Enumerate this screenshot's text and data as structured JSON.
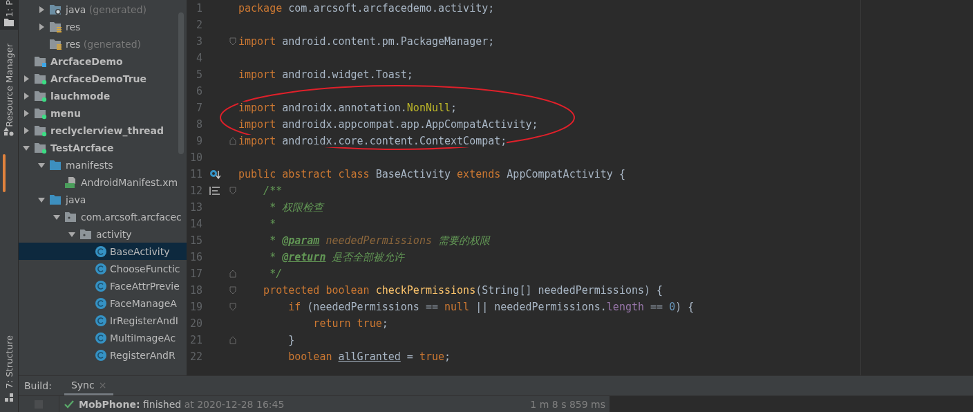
{
  "tool_strip": {
    "top_tab": "1: P",
    "middle_tab": "Resource Manager",
    "bottom_tab": "7: Structure"
  },
  "project_tree": {
    "scrolled_children": [
      {
        "label": "java",
        "suffix": "(generated)",
        "kind": "folder-generated",
        "expanded": false
      },
      {
        "label": "res",
        "kind": "folder-resources",
        "expanded": false
      },
      {
        "label": "res",
        "suffix": "(generated)",
        "kind": "folder-resources"
      }
    ],
    "items": [
      {
        "label": "ArcfaceDemo",
        "kind": "module-blue",
        "bold": true
      },
      {
        "label": "ArcfaceDemoTrue",
        "kind": "module-android",
        "bold": true,
        "expanded": false
      },
      {
        "label": "lauchmode",
        "kind": "module-android",
        "bold": true,
        "expanded": false
      },
      {
        "label": "menu",
        "kind": "module-android",
        "bold": true,
        "expanded": false
      },
      {
        "label": "reclyclerview_thread",
        "kind": "module-android",
        "bold": true,
        "expanded": false
      },
      {
        "label": "TestArcface",
        "kind": "module-android",
        "bold": true,
        "expanded": true,
        "children": [
          {
            "label": "manifests",
            "kind": "folder-blue",
            "expanded": true,
            "children": [
              {
                "label": "AndroidManifest.xm",
                "kind": "manifest"
              }
            ]
          },
          {
            "label": "java",
            "kind": "folder-blue",
            "expanded": true,
            "children": [
              {
                "label": "com.arcsoft.arcfacec",
                "kind": "package",
                "expanded": true,
                "children": [
                  {
                    "label": "activity",
                    "kind": "package",
                    "expanded": true,
                    "children": [
                      {
                        "label": "BaseActivity",
                        "kind": "class",
                        "selected": true
                      },
                      {
                        "label": "ChooseFunctic",
                        "kind": "class",
                        "selected": false
                      },
                      {
                        "label": "FaceAttrPrevie",
                        "kind": "class",
                        "selected": false
                      },
                      {
                        "label": "FaceManageA",
                        "kind": "class",
                        "selected": false
                      },
                      {
                        "label": "IrRegisterAndI",
                        "kind": "class",
                        "selected": false
                      },
                      {
                        "label": "MultiImageAc",
                        "kind": "class",
                        "selected": false
                      },
                      {
                        "label": "RegisterAndR",
                        "kind": "class",
                        "selected": false
                      }
                    ]
                  }
                ]
              }
            ]
          }
        ]
      }
    ]
  },
  "editor": {
    "lines": [
      {
        "number": "1",
        "tokens": [
          {
            "text": "package",
            "kind": "keyword"
          },
          {
            "text": " com.arcsoft.arcfacedemo.activity;",
            "kind": "plain"
          }
        ]
      },
      {
        "number": "2"
      },
      {
        "number": "3",
        "kind": "fold-open",
        "tokens": [
          {
            "text": "import",
            "kind": "keyword"
          },
          {
            "text": " android.content.pm.PackageManager;",
            "kind": "plain"
          }
        ]
      },
      {
        "number": "4"
      },
      {
        "number": "5",
        "tokens": [
          {
            "text": "import",
            "kind": "keyword"
          },
          {
            "text": " android.widget.Toast;",
            "kind": "plain"
          }
        ]
      },
      {
        "number": "6"
      },
      {
        "number": "7",
        "tokens": [
          {
            "text": "import",
            "kind": "keyword"
          },
          {
            "text": " androidx.annotation.",
            "kind": "plain"
          },
          {
            "text": "NonNull",
            "kind": "annotation"
          },
          {
            "text": ";",
            "kind": "plain"
          }
        ]
      },
      {
        "number": "8",
        "tokens": [
          {
            "text": "import",
            "kind": "keyword"
          },
          {
            "text": " androidx.appcompat.app.AppCompatActivity;",
            "kind": "plain"
          }
        ]
      },
      {
        "number": "9",
        "kind": "fold-close",
        "tokens": [
          {
            "text": "import",
            "kind": "keyword"
          },
          {
            "text": " androidx.core.content.ContextCompat;",
            "kind": "plain"
          }
        ]
      },
      {
        "number": "10"
      },
      {
        "number": "11",
        "kind": "override",
        "tokens": [
          {
            "text": "public abstract class",
            "kind": "keyword"
          },
          {
            "text": " BaseActivity ",
            "kind": "plain"
          },
          {
            "text": "extends",
            "kind": "keyword"
          },
          {
            "text": " AppCompatActivity {",
            "kind": "plain"
          }
        ]
      },
      {
        "number": "12",
        "kind": "doc-fold-open",
        "tokens": [
          {
            "text": "    /**",
            "kind": "doc"
          }
        ]
      },
      {
        "number": "13",
        "tokens": [
          {
            "text": "     * 权限检查",
            "kind": "doc"
          }
        ]
      },
      {
        "number": "14",
        "tokens": [
          {
            "text": "     *",
            "kind": "doc"
          }
        ]
      },
      {
        "number": "15",
        "tokens": [
          {
            "text": "     * ",
            "kind": "doc"
          },
          {
            "text": "@param",
            "kind": "doc-tag"
          },
          {
            "text": " neededPermissions",
            "kind": "doc-param"
          },
          {
            "text": " 需要的权限",
            "kind": "doc"
          }
        ]
      },
      {
        "number": "16",
        "tokens": [
          {
            "text": "     * ",
            "kind": "doc"
          },
          {
            "text": "@return",
            "kind": "doc-tag"
          },
          {
            "text": " 是否全部被允许",
            "kind": "doc"
          }
        ]
      },
      {
        "number": "17",
        "kind": "fold-close",
        "tokens": [
          {
            "text": "     */",
            "kind": "doc"
          }
        ]
      },
      {
        "number": "18",
        "kind": "fold-open",
        "tokens": [
          {
            "text": "    protected boolean",
            "kind": "keyword"
          },
          {
            "text": " checkPermissions",
            "kind": "method"
          },
          {
            "text": "(String[] neededPermissions) {",
            "kind": "plain"
          }
        ]
      },
      {
        "number": "19",
        "kind": "fold-open",
        "tokens": [
          {
            "text": "        if",
            "kind": "keyword"
          },
          {
            "text": " (neededPermissions == ",
            "kind": "plain"
          },
          {
            "text": "null",
            "kind": "keyword"
          },
          {
            "text": " || neededPermissions.",
            "kind": "plain"
          },
          {
            "text": "length",
            "kind": "field"
          },
          {
            "text": " == ",
            "kind": "plain"
          },
          {
            "text": "0",
            "kind": "number"
          },
          {
            "text": ") {",
            "kind": "plain"
          }
        ]
      },
      {
        "number": "20",
        "tokens": [
          {
            "text": "            return true",
            "kind": "keyword"
          },
          {
            "text": ";",
            "kind": "plain"
          }
        ]
      },
      {
        "number": "21",
        "kind": "fold-close",
        "tokens": [
          {
            "text": "        }",
            "kind": "plain"
          }
        ]
      },
      {
        "number": "22",
        "tokens": [
          {
            "text": "        boolean ",
            "kind": "keyword"
          },
          {
            "text": "allGranted",
            "kind": "reassigned"
          },
          {
            "text": " = ",
            "kind": "plain"
          },
          {
            "text": "true",
            "kind": "keyword"
          },
          {
            "text": ";",
            "kind": "plain"
          }
        ]
      }
    ]
  },
  "build_panel": {
    "label": "Build:",
    "tabs": [
      {
        "label": "Sync",
        "selected": true,
        "close": "×"
      }
    ],
    "rows": [
      {
        "kind": "success",
        "project": "MobPhone:",
        "message": "finished",
        "time": "at 2020-12-28 16:45",
        "duration": "1 m 8 s 859 ms"
      }
    ]
  }
}
